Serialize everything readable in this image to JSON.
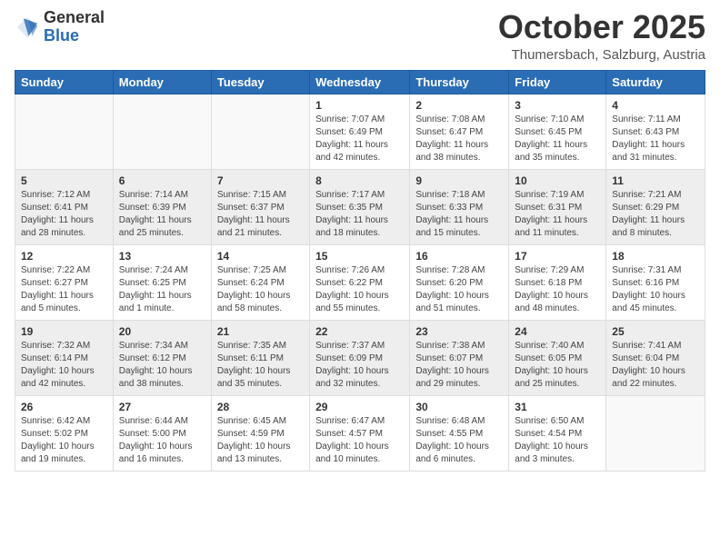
{
  "header": {
    "logo_general": "General",
    "logo_blue": "Blue",
    "main_title": "October 2025",
    "subtitle": "Thumersbach, Salzburg, Austria"
  },
  "calendar": {
    "days_of_week": [
      "Sunday",
      "Monday",
      "Tuesday",
      "Wednesday",
      "Thursday",
      "Friday",
      "Saturday"
    ],
    "rows": [
      [
        {
          "day": "",
          "info": ""
        },
        {
          "day": "",
          "info": ""
        },
        {
          "day": "",
          "info": ""
        },
        {
          "day": "1",
          "info": "Sunrise: 7:07 AM\nSunset: 6:49 PM\nDaylight: 11 hours and 42 minutes."
        },
        {
          "day": "2",
          "info": "Sunrise: 7:08 AM\nSunset: 6:47 PM\nDaylight: 11 hours and 38 minutes."
        },
        {
          "day": "3",
          "info": "Sunrise: 7:10 AM\nSunset: 6:45 PM\nDaylight: 11 hours and 35 minutes."
        },
        {
          "day": "4",
          "info": "Sunrise: 7:11 AM\nSunset: 6:43 PM\nDaylight: 11 hours and 31 minutes."
        }
      ],
      [
        {
          "day": "5",
          "info": "Sunrise: 7:12 AM\nSunset: 6:41 PM\nDaylight: 11 hours and 28 minutes."
        },
        {
          "day": "6",
          "info": "Sunrise: 7:14 AM\nSunset: 6:39 PM\nDaylight: 11 hours and 25 minutes."
        },
        {
          "day": "7",
          "info": "Sunrise: 7:15 AM\nSunset: 6:37 PM\nDaylight: 11 hours and 21 minutes."
        },
        {
          "day": "8",
          "info": "Sunrise: 7:17 AM\nSunset: 6:35 PM\nDaylight: 11 hours and 18 minutes."
        },
        {
          "day": "9",
          "info": "Sunrise: 7:18 AM\nSunset: 6:33 PM\nDaylight: 11 hours and 15 minutes."
        },
        {
          "day": "10",
          "info": "Sunrise: 7:19 AM\nSunset: 6:31 PM\nDaylight: 11 hours and 11 minutes."
        },
        {
          "day": "11",
          "info": "Sunrise: 7:21 AM\nSunset: 6:29 PM\nDaylight: 11 hours and 8 minutes."
        }
      ],
      [
        {
          "day": "12",
          "info": "Sunrise: 7:22 AM\nSunset: 6:27 PM\nDaylight: 11 hours and 5 minutes."
        },
        {
          "day": "13",
          "info": "Sunrise: 7:24 AM\nSunset: 6:25 PM\nDaylight: 11 hours and 1 minute."
        },
        {
          "day": "14",
          "info": "Sunrise: 7:25 AM\nSunset: 6:24 PM\nDaylight: 10 hours and 58 minutes."
        },
        {
          "day": "15",
          "info": "Sunrise: 7:26 AM\nSunset: 6:22 PM\nDaylight: 10 hours and 55 minutes."
        },
        {
          "day": "16",
          "info": "Sunrise: 7:28 AM\nSunset: 6:20 PM\nDaylight: 10 hours and 51 minutes."
        },
        {
          "day": "17",
          "info": "Sunrise: 7:29 AM\nSunset: 6:18 PM\nDaylight: 10 hours and 48 minutes."
        },
        {
          "day": "18",
          "info": "Sunrise: 7:31 AM\nSunset: 6:16 PM\nDaylight: 10 hours and 45 minutes."
        }
      ],
      [
        {
          "day": "19",
          "info": "Sunrise: 7:32 AM\nSunset: 6:14 PM\nDaylight: 10 hours and 42 minutes."
        },
        {
          "day": "20",
          "info": "Sunrise: 7:34 AM\nSunset: 6:12 PM\nDaylight: 10 hours and 38 minutes."
        },
        {
          "day": "21",
          "info": "Sunrise: 7:35 AM\nSunset: 6:11 PM\nDaylight: 10 hours and 35 minutes."
        },
        {
          "day": "22",
          "info": "Sunrise: 7:37 AM\nSunset: 6:09 PM\nDaylight: 10 hours and 32 minutes."
        },
        {
          "day": "23",
          "info": "Sunrise: 7:38 AM\nSunset: 6:07 PM\nDaylight: 10 hours and 29 minutes."
        },
        {
          "day": "24",
          "info": "Sunrise: 7:40 AM\nSunset: 6:05 PM\nDaylight: 10 hours and 25 minutes."
        },
        {
          "day": "25",
          "info": "Sunrise: 7:41 AM\nSunset: 6:04 PM\nDaylight: 10 hours and 22 minutes."
        }
      ],
      [
        {
          "day": "26",
          "info": "Sunrise: 6:42 AM\nSunset: 5:02 PM\nDaylight: 10 hours and 19 minutes."
        },
        {
          "day": "27",
          "info": "Sunrise: 6:44 AM\nSunset: 5:00 PM\nDaylight: 10 hours and 16 minutes."
        },
        {
          "day": "28",
          "info": "Sunrise: 6:45 AM\nSunset: 4:59 PM\nDaylight: 10 hours and 13 minutes."
        },
        {
          "day": "29",
          "info": "Sunrise: 6:47 AM\nSunset: 4:57 PM\nDaylight: 10 hours and 10 minutes."
        },
        {
          "day": "30",
          "info": "Sunrise: 6:48 AM\nSunset: 4:55 PM\nDaylight: 10 hours and 6 minutes."
        },
        {
          "day": "31",
          "info": "Sunrise: 6:50 AM\nSunset: 4:54 PM\nDaylight: 10 hours and 3 minutes."
        },
        {
          "day": "",
          "info": ""
        }
      ]
    ]
  }
}
